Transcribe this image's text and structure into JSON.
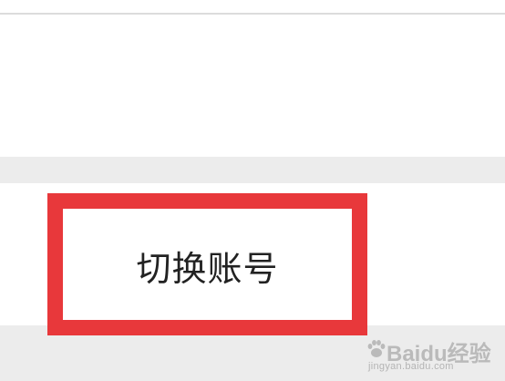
{
  "menu": {
    "switch_account_label": "切换账号"
  },
  "watermark": {
    "brand": "Baidu",
    "brand_suffix": "经验",
    "url": "jingyan.baidu.com",
    "icon": "paw-icon"
  },
  "colors": {
    "highlight_border": "#e8383b",
    "section_gap": "#ececec",
    "divider": "#dcdcdc",
    "label_text": "#222222"
  }
}
